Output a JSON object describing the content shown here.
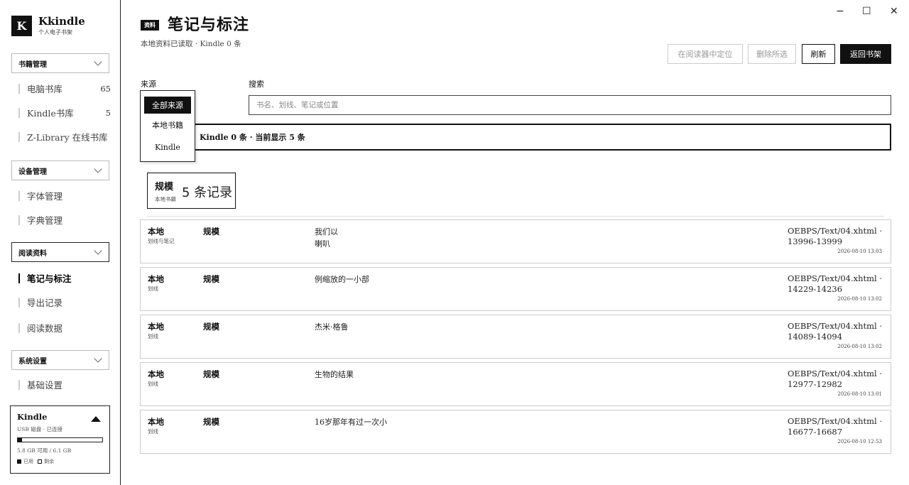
{
  "app": {
    "logo_letter": "K",
    "title": "Kkindle",
    "subtitle": "个人电子书架"
  },
  "window_controls": {
    "minimize": "−",
    "maximize": "☐",
    "close": "✕"
  },
  "sidebar": {
    "groups": [
      {
        "label": "书籍管理",
        "items": [
          {
            "label": "电脑书库",
            "count": "65"
          },
          {
            "label": "Kindle书库",
            "count": "5"
          },
          {
            "label": "Z-Library 在线书库",
            "count": ""
          }
        ]
      },
      {
        "label": "设备管理",
        "items": [
          {
            "label": "字体管理"
          },
          {
            "label": "字典管理"
          }
        ]
      },
      {
        "label": "阅读资料",
        "items": [
          {
            "label": "笔记与标注",
            "active": true
          },
          {
            "label": "导出记录"
          },
          {
            "label": "阅读数据"
          }
        ]
      },
      {
        "label": "系统设置",
        "items": [
          {
            "label": "基础设置"
          }
        ]
      }
    ]
  },
  "device": {
    "name": "Kindle",
    "status": "USB 磁盘 · 已连接",
    "space": "5.8 GB 可用 / 6.1 GB",
    "used_fraction": 0.05,
    "legend_used": "已用",
    "legend_free": "剩余"
  },
  "header": {
    "tag": "资料",
    "title": "笔记与标注",
    "subtitle": "本地资料已读取 · Kindle 0 条"
  },
  "toolbar": {
    "locate": "在阅读器中定位",
    "delete_selected": "删除所选",
    "refresh": "刷新",
    "back": "返回书架"
  },
  "filters": {
    "source_label": "来源",
    "search_label": "搜索",
    "search_placeholder": "书名、划线、笔记或位置",
    "source_options": [
      "全部来源",
      "本地书籍",
      "Kindle"
    ],
    "selected_source": "全部来源"
  },
  "summary": "Kindle 0 条 · 当前显示 5 条",
  "book_card": {
    "name": "规模",
    "source": "本地书籍",
    "count": "5 条记录"
  },
  "records": [
    {
      "source": "本地",
      "kind": "划线与笔记",
      "book": "规模",
      "text": "我们以\n喇叭",
      "location": "OEBPS/Text/04.xhtml · 13996-13999",
      "time": "2026-08-10 13:03"
    },
    {
      "source": "本地",
      "kind": "划线",
      "book": "规模",
      "text": "例缩放的一小部",
      "location": "OEBPS/Text/04.xhtml · 14229-14236",
      "time": "2026-08-10 13:02"
    },
    {
      "source": "本地",
      "kind": "划线",
      "book": "规模",
      "text": "杰米·格鲁",
      "location": "OEBPS/Text/04.xhtml · 14089-14094",
      "time": "2026-08-10 13:02"
    },
    {
      "source": "本地",
      "kind": "划线",
      "book": "规模",
      "text": "生物的结果",
      "location": "OEBPS/Text/04.xhtml · 12977-12982",
      "time": "2026-08-10 13:01"
    },
    {
      "source": "本地",
      "kind": "划线",
      "book": "规模",
      "text": "16岁那年有过一次小",
      "location": "OEBPS/Text/04.xhtml · 16677-16687",
      "time": "2026-08-10 12:53"
    }
  ]
}
